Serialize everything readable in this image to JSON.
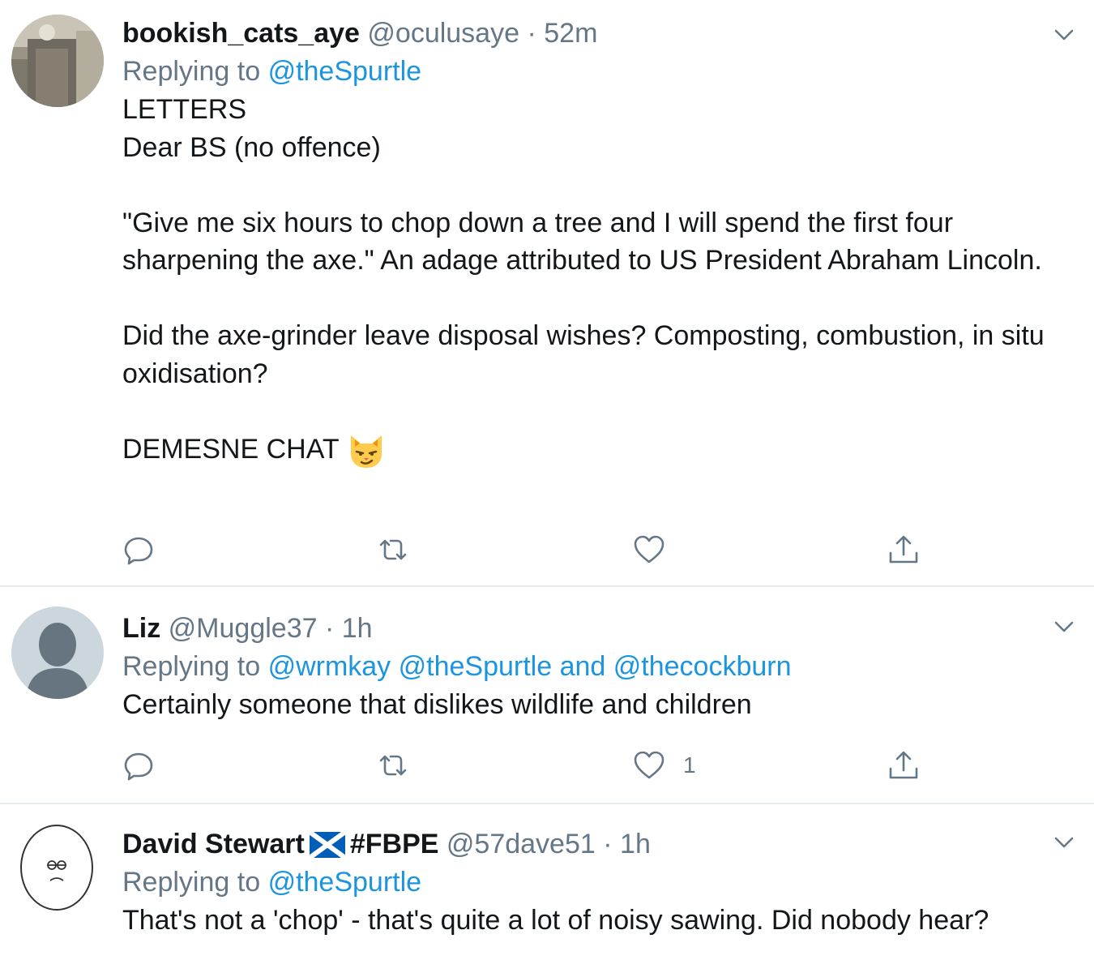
{
  "tweets": [
    {
      "name": "bookish_cats_aye",
      "handle": "@oculusaye",
      "separator": "·",
      "time": "52m",
      "replying_prefix": "Replying to",
      "replying_to": "@theSpurtle",
      "lines": [
        "LETTERS",
        "Dear BS (no offence)",
        "\"Give me six hours to chop down a tree and I will spend the first four sharpening the axe.\" An adage attributed to US President Abraham Lincoln.",
        "Did the axe-grinder leave disposal wishes? Composting, combustion, in situ oxidisation?",
        "DEMESNE CHAT"
      ],
      "emoji": "smirking-cat-face",
      "like_count": ""
    },
    {
      "name": "Liz",
      "handle": "@Muggle37",
      "separator": "·",
      "time": "1h",
      "replying_prefix": "Replying to",
      "replying_to": "@wrmkay @theSpurtle and @thecockburn",
      "lines": [
        "Certainly someone that dislikes wildlife and children"
      ],
      "like_count": "1"
    },
    {
      "name": "David Stewart",
      "name_suffix": "#FBPE",
      "flag_icon": "scotland-flag-icon",
      "handle": "@57dave51",
      "separator": "·",
      "time": "1h",
      "replying_prefix": "Replying to",
      "replying_to": "@theSpurtle",
      "lines": [
        "That's not a 'chop' - that's quite a lot of noisy sawing. Did nobody hear?"
      ]
    }
  ],
  "colors": {
    "text": "#14171a",
    "muted": "#657786",
    "link": "#1b95e0",
    "divider": "#e6ecf0"
  }
}
